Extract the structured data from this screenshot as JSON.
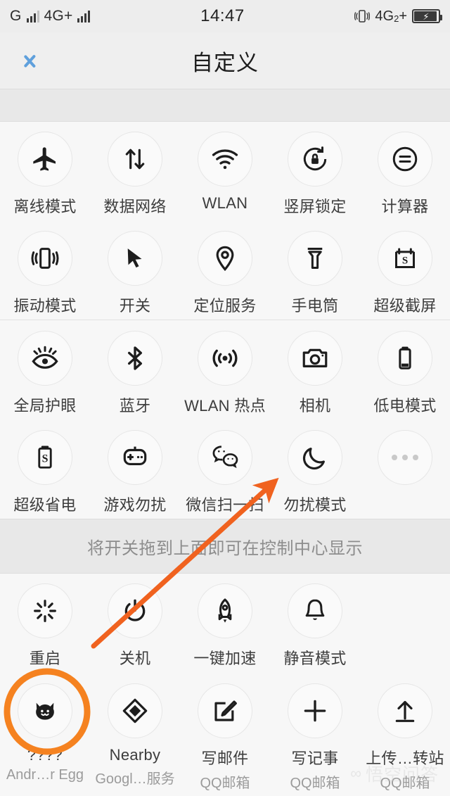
{
  "status_bar": {
    "carrier_1_label": "G",
    "carrier_2_label": "4G+",
    "clock": "14:47",
    "network_right": "4G",
    "network_right_sub": "2",
    "network_right_plus": "+",
    "vibrate_icon": "vibrate-icon",
    "battery_icon": "battery-charging-icon"
  },
  "header": {
    "back_icon": "chevron-left-icon",
    "title": "自定义"
  },
  "hint": {
    "text": "将开关拖到上面即可在控制中心显示"
  },
  "grid_a": {
    "tiles": [
      {
        "label": "离线模式",
        "icon": "airplane-icon"
      },
      {
        "label": "数据网络",
        "icon": "data-transfer-icon"
      },
      {
        "label": "WLAN",
        "icon": "wifi-icon"
      },
      {
        "label": "竖屏锁定",
        "icon": "rotation-lock-icon"
      },
      {
        "label": "计算器",
        "icon": "calculator-icon"
      },
      {
        "label": "振动模式",
        "icon": "vibrate-icon"
      },
      {
        "label": "开关",
        "icon": "cursor-pointer-icon"
      },
      {
        "label": "定位服务",
        "icon": "location-pin-icon"
      },
      {
        "label": "手电筒",
        "icon": "flashlight-icon"
      },
      {
        "label": "超级截屏",
        "icon": "super-screenshot-icon"
      }
    ]
  },
  "grid_b": {
    "tiles": [
      {
        "label": "全局护眼",
        "icon": "eye-care-icon"
      },
      {
        "label": "蓝牙",
        "icon": "bluetooth-icon"
      },
      {
        "label": "WLAN 热点",
        "icon": "hotspot-icon"
      },
      {
        "label": "相机",
        "icon": "camera-icon"
      },
      {
        "label": "低电模式",
        "icon": "low-battery-icon"
      },
      {
        "label": "超级省电",
        "icon": "super-power-save-icon"
      },
      {
        "label": "游戏勿扰",
        "icon": "game-dnd-icon"
      },
      {
        "label": "微信扫一扫",
        "icon": "wechat-scan-icon"
      },
      {
        "label": "勿扰模式",
        "icon": "moon-icon"
      },
      {
        "label": "",
        "icon": "more-dots-icon"
      }
    ]
  },
  "grid_c": {
    "tiles": [
      {
        "label": "重启",
        "sub": "",
        "icon": "restart-icon"
      },
      {
        "label": "关机",
        "sub": "",
        "icon": "power-off-icon"
      },
      {
        "label": "一键加速",
        "sub": "",
        "icon": "rocket-boost-icon"
      },
      {
        "label": "静音模式",
        "sub": "",
        "icon": "bell-mute-icon"
      },
      {
        "label": "",
        "sub": "",
        "icon": ""
      },
      {
        "label": "????",
        "sub": "Andr…r Egg",
        "icon": "android-easter-egg-cat-icon"
      },
      {
        "label": "Nearby",
        "sub": "Googl…服务",
        "icon": "nearby-diamond-icon"
      },
      {
        "label": "写邮件",
        "sub": "QQ邮箱",
        "icon": "compose-mail-icon"
      },
      {
        "label": "写记事",
        "sub": "QQ邮箱",
        "icon": "plus-note-icon"
      },
      {
        "label": "上传…转站",
        "sub": "QQ邮箱",
        "icon": "upload-icon"
      }
    ]
  },
  "annotations": {
    "arrow_color": "#f0621f",
    "highlight_circle_color": "#f58220"
  },
  "watermark": {
    "logo": "∞",
    "text": "悟空问答"
  }
}
